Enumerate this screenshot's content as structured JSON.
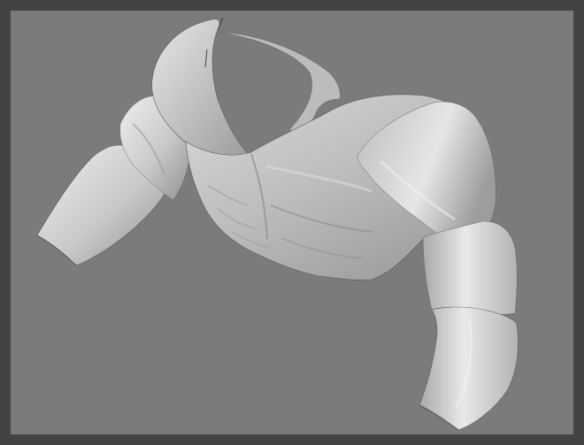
{
  "viewport": {
    "background": "#7b7b7b",
    "frame_color": "#434343"
  },
  "model": {
    "subject": "sculpted-male-torso-with-arms",
    "material_color": "#c8c8c8"
  }
}
